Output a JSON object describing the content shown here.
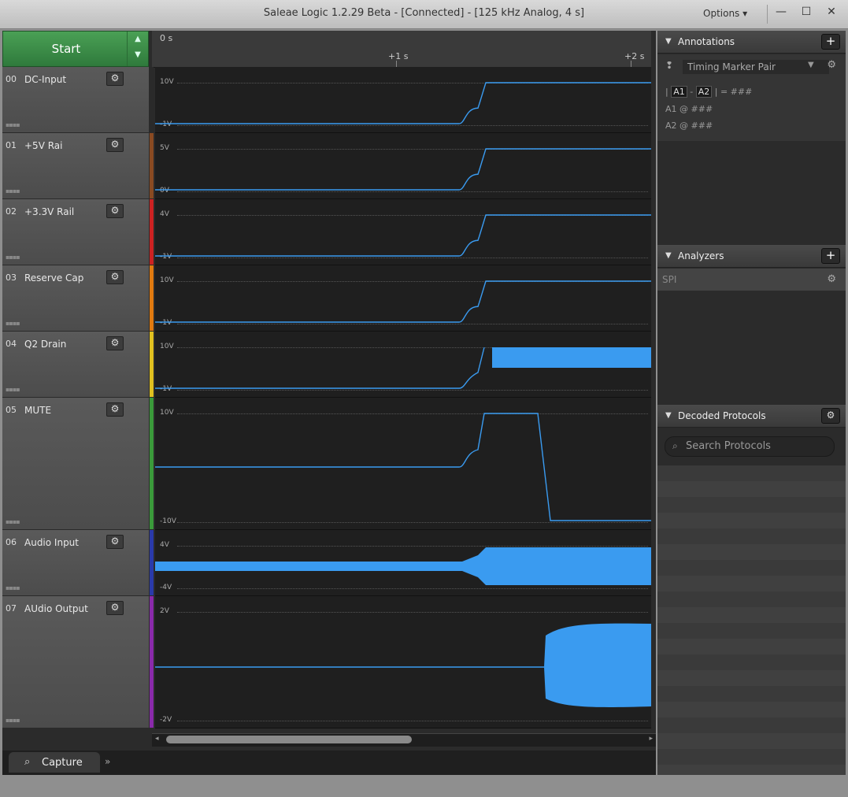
{
  "window": {
    "title": "Saleae Logic 1.2.29 Beta - [Connected] - [125 kHz Analog, 4 s]",
    "options_label": "Options",
    "minimize_glyph": "—",
    "maximize_glyph": "☐",
    "close_glyph": "✕"
  },
  "start_button": {
    "label": "Start"
  },
  "timeline": {
    "t0": "0 s",
    "t1": "+1 s",
    "t2": "+2 s"
  },
  "channels": [
    {
      "num": "00",
      "name": "DC-Input",
      "ymax": "10V",
      "ymin": "-1V",
      "color": "#2a2a2a"
    },
    {
      "num": "01",
      "name": "+5V Rai",
      "ymax": "5V",
      "ymin": "0V",
      "color": "#8a4a22"
    },
    {
      "num": "02",
      "name": "+3.3V Rail",
      "ymax": "4V",
      "ymin": "-1V",
      "color": "#cc2222"
    },
    {
      "num": "03",
      "name": "Reserve Cap",
      "ymax": "10V",
      "ymin": "-1V",
      "color": "#e07a10"
    },
    {
      "num": "04",
      "name": "Q2 Drain",
      "ymax": "10V",
      "ymin": "-1V",
      "color": "#e0c020"
    },
    {
      "num": "05",
      "name": "MUTE",
      "ymax": "10V",
      "ymin": "-10V",
      "color": "#3a9a3a"
    },
    {
      "num": "06",
      "name": "Audio Input",
      "ymax": "4V",
      "ymin": "-4V",
      "color": "#2a3aaa"
    },
    {
      "num": "07",
      "name": "AUdio Output",
      "ymax": "2V",
      "ymin": "-2V",
      "color": "#8a2aaa"
    }
  ],
  "tabs": {
    "capture_label": "Capture",
    "more_glyph": "»"
  },
  "annotations": {
    "header": "Annotations",
    "selector": "Timing Marker Pair",
    "row1_a1": "A1",
    "row1_a2": "A2",
    "row1_sep": "-",
    "row1_value": "= ###",
    "row2": "A1  @  ###",
    "row3": "A2  @  ###"
  },
  "analyzers": {
    "header": "Analyzers",
    "items": [
      "SPI"
    ]
  },
  "decoded": {
    "header": "Decoded Protocols",
    "search_placeholder": "Search Protocols"
  },
  "colors": {
    "waveform": "#3a9bf0",
    "accent_green": "#3d8f48"
  }
}
